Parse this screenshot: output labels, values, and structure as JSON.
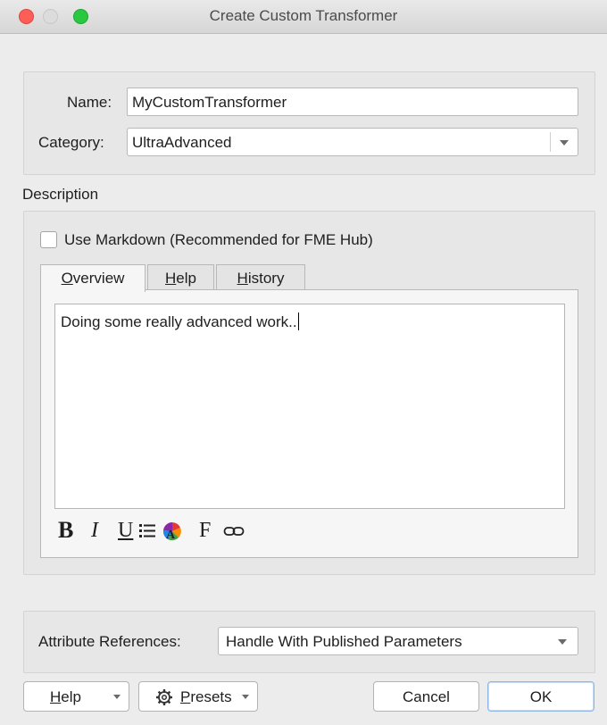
{
  "window": {
    "title": "Create Custom Transformer"
  },
  "form": {
    "name_label": "Name:",
    "name_value": "MyCustomTransformer",
    "category_label": "Category:",
    "category_value": "UltraAdvanced"
  },
  "description": {
    "section_label": "Description",
    "markdown_checkbox_label": "Use Markdown (Recommended for FME Hub)",
    "markdown_checked": false,
    "tabs": [
      {
        "label_prefix": "",
        "mnemonic": "O",
        "label_rest": "verview",
        "active": true
      },
      {
        "label_prefix": "",
        "mnemonic": "H",
        "label_rest": "elp",
        "active": false
      },
      {
        "label_prefix": "",
        "mnemonic": "H",
        "label_rest": "istory",
        "active": false
      }
    ],
    "editor_text": "Doing some really advanced work..",
    "toolbar": {
      "bold": "B",
      "italic": "I",
      "underline": "U",
      "font": "F"
    }
  },
  "attribute_references": {
    "label": "Attribute References:",
    "value": "Handle With Published Parameters"
  },
  "buttons": {
    "help_mnemonic": "H",
    "help_rest": "elp",
    "presets_mnemonic": "P",
    "presets_rest": "resets",
    "cancel": "Cancel",
    "ok": "OK"
  },
  "colors": {
    "traffic_red": "#fd5e57",
    "traffic_green": "#28c940",
    "ok_border": "#8fb6e6"
  },
  "icons": [
    "close-icon",
    "minimize-icon",
    "zoom-icon",
    "chevron-down-icon",
    "list-icon",
    "color-palette-icon",
    "link-icon",
    "gear-icon"
  ]
}
